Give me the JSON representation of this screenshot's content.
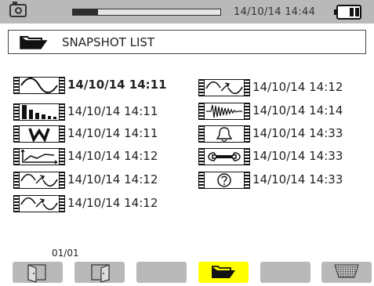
{
  "status_bar": {
    "datetime": "14/10/14  14:44",
    "progress": 0.17,
    "camera_icon": "camera-icon",
    "battery_icon": "battery-icon"
  },
  "header": {
    "title": "SNAPSHOT LIST",
    "icon": "open-folder-icon"
  },
  "snapshots": {
    "left": [
      {
        "icon": "waveform-icon",
        "timestamp": "14/10/14 14:11",
        "selected": true
      },
      {
        "icon": "harmonics-icon",
        "timestamp": "14/10/14 14:11",
        "selected": false
      },
      {
        "icon": "power-w-icon",
        "timestamp": "14/10/14 14:11",
        "selected": false
      },
      {
        "icon": "trend-icon",
        "timestamp": "14/10/14 14:12",
        "selected": false
      },
      {
        "icon": "transient-icon",
        "timestamp": "14/10/14 14:12",
        "selected": false
      },
      {
        "icon": "transient-icon",
        "timestamp": "14/10/14 14:12",
        "selected": false
      }
    ],
    "right": [
      {
        "icon": "transient-icon",
        "timestamp": "14/10/14 14:12",
        "selected": false
      },
      {
        "icon": "inrush-icon",
        "timestamp": "14/10/14 14:14",
        "selected": false
      },
      {
        "icon": "alarm-bell-icon",
        "timestamp": "14/10/14 14:33",
        "selected": false
      },
      {
        "icon": "setup-wrench-icon",
        "timestamp": "14/10/14 14:33",
        "selected": false
      },
      {
        "icon": "help-icon",
        "timestamp": "14/10/14 14:33",
        "selected": false
      }
    ]
  },
  "page_indicator": "01/01",
  "soft_keys": [
    {
      "icon": "open-left-icon",
      "active": false
    },
    {
      "icon": "open-right-icon",
      "active": false
    },
    {
      "icon": "",
      "active": false
    },
    {
      "icon": "open-folder-icon",
      "active": true
    },
    {
      "icon": "",
      "active": false
    },
    {
      "icon": "trash-icon",
      "active": false
    }
  ]
}
